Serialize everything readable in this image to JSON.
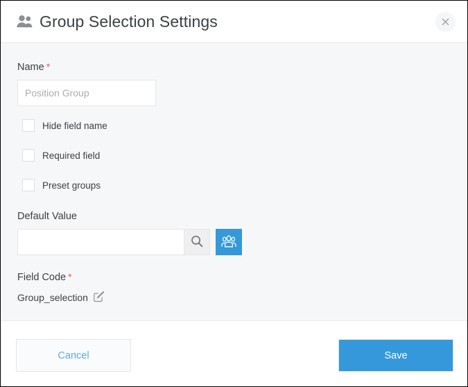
{
  "dialog": {
    "title": "Group Selection Settings",
    "title_icon": "group-users-icon",
    "close_icon": "close-icon"
  },
  "form": {
    "name": {
      "label": "Name",
      "required_marker": "*",
      "value": "",
      "placeholder": "Position Group"
    },
    "checkboxes": [
      {
        "label": "Hide field name",
        "checked": false
      },
      {
        "label": "Required field",
        "checked": false
      },
      {
        "label": "Preset groups",
        "checked": false
      }
    ],
    "default_value": {
      "label": "Default Value",
      "value": "",
      "placeholder": "",
      "search_icon": "search-icon",
      "group_picker_icon": "group-users-icon"
    },
    "field_code": {
      "label": "Field Code",
      "required_marker": "*",
      "value": "Group_selection",
      "edit_icon": "edit-pencil-icon"
    }
  },
  "footer": {
    "cancel_label": "Cancel",
    "save_label": "Save"
  },
  "colors": {
    "accent_blue": "#3498db",
    "link_blue": "#5aaae4",
    "required_red": "#e8584f",
    "body_background": "#f6f7f9",
    "text": "#3b4043",
    "placeholder": "#a9adb1",
    "border": "#e3e5e7"
  }
}
